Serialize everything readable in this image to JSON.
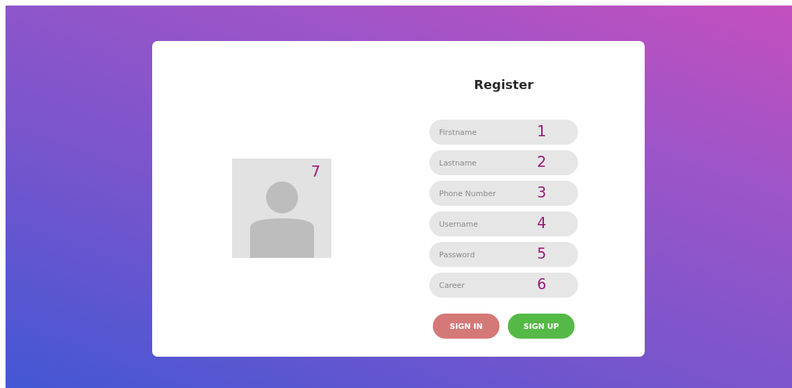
{
  "title": "Register",
  "avatar": {
    "annotation": "7"
  },
  "fields": [
    {
      "placeholder": "Firstname",
      "annotation": "1"
    },
    {
      "placeholder": "Lastname",
      "annotation": "2"
    },
    {
      "placeholder": "Phone Number",
      "annotation": "3"
    },
    {
      "placeholder": "Username",
      "annotation": "4"
    },
    {
      "placeholder": "Password",
      "annotation": "5"
    },
    {
      "placeholder": "Career",
      "annotation": "6"
    }
  ],
  "buttons": [
    {
      "label": "SIGN IN",
      "kind": "secondary"
    },
    {
      "label": "SIGN UP",
      "kind": "primary"
    }
  ]
}
